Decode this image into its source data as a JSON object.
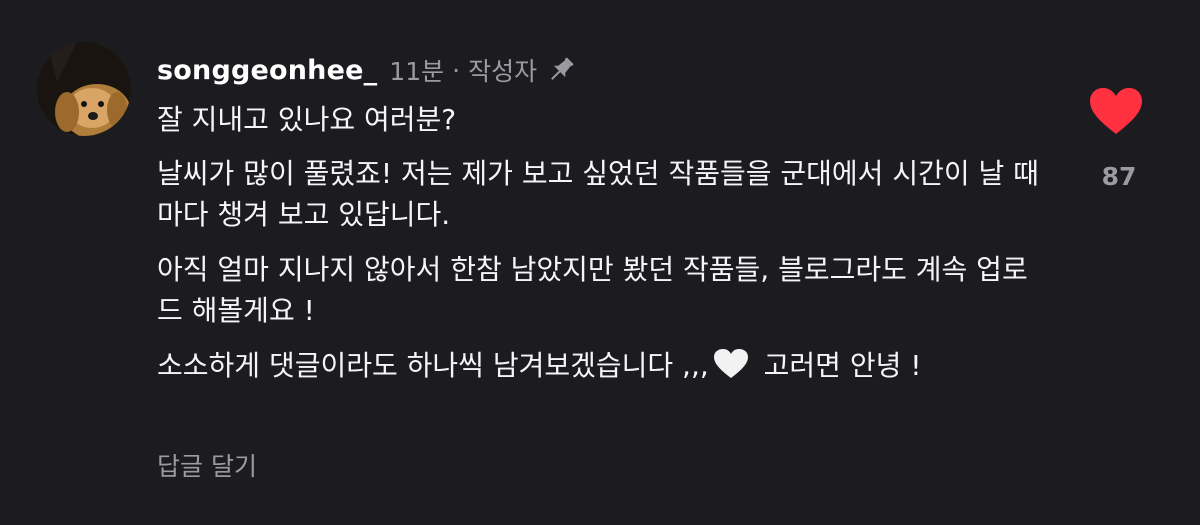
{
  "comment": {
    "author": "songgeonhee_",
    "time": "11분",
    "separator": "·",
    "author_tag": "작성자",
    "lines": {
      "l1": "잘 지내고 있나요 여러분?",
      "l2": "날씨가 많이 풀렸죠! 저는 제가 보고 싶었던 작품들을 군대에서 시간이 날 때 마다 챙겨 보고 있답니다.",
      "l3": "아직 얼마 지나지 않아서 한참 남았지만  봤던 작품들, 블로그라도 계속 업로드 해볼게요 !",
      "l4_before": "소소하게 댓글이라도 하나씩 남겨보겠습니다 ,,,",
      "l4_after": " 고러면 안녕 !"
    },
    "reply_label": "답글 달기",
    "like_count": "87"
  },
  "icons": {
    "pin": "pin-icon",
    "like": "heart-icon",
    "emoji": "white-heart-emoji"
  },
  "colors": {
    "background": "#1c1c20",
    "like": "#ff3040",
    "muted": "#9a9aa0"
  }
}
